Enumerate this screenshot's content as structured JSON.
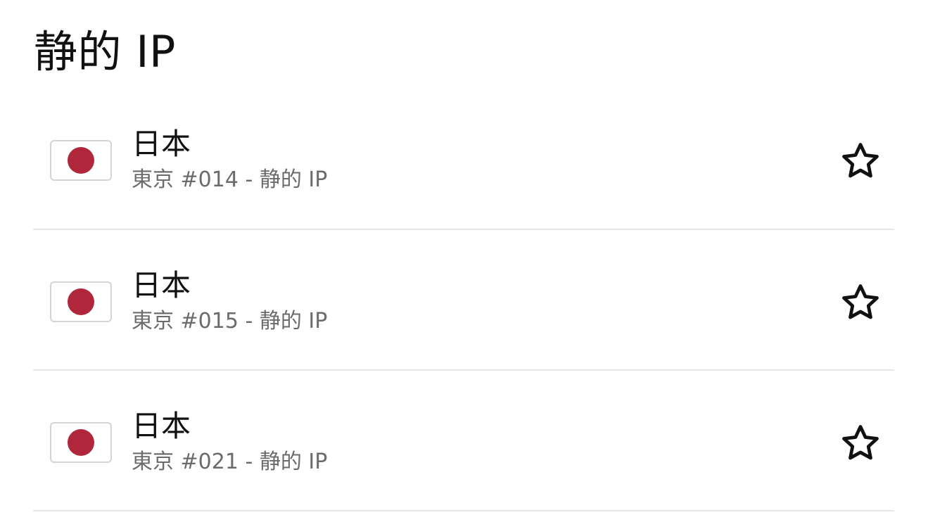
{
  "page": {
    "title": "静的 IP"
  },
  "servers": [
    {
      "country": "日本",
      "location": "東京 #014 - 静的 IP",
      "flag_icon": "japan-flag-icon",
      "favorite": false
    },
    {
      "country": "日本",
      "location": "東京 #015 - 静的 IP",
      "flag_icon": "japan-flag-icon",
      "favorite": false
    },
    {
      "country": "日本",
      "location": "東京 #021 - 静的 IP",
      "flag_icon": "japan-flag-icon",
      "favorite": false
    }
  ],
  "colors": {
    "flag_red": "#b0263a",
    "divider": "#e6e6e6",
    "primary_text": "#111111",
    "secondary_text": "#6b6b6b"
  },
  "icons": {
    "favorite": "star-outline-icon"
  }
}
